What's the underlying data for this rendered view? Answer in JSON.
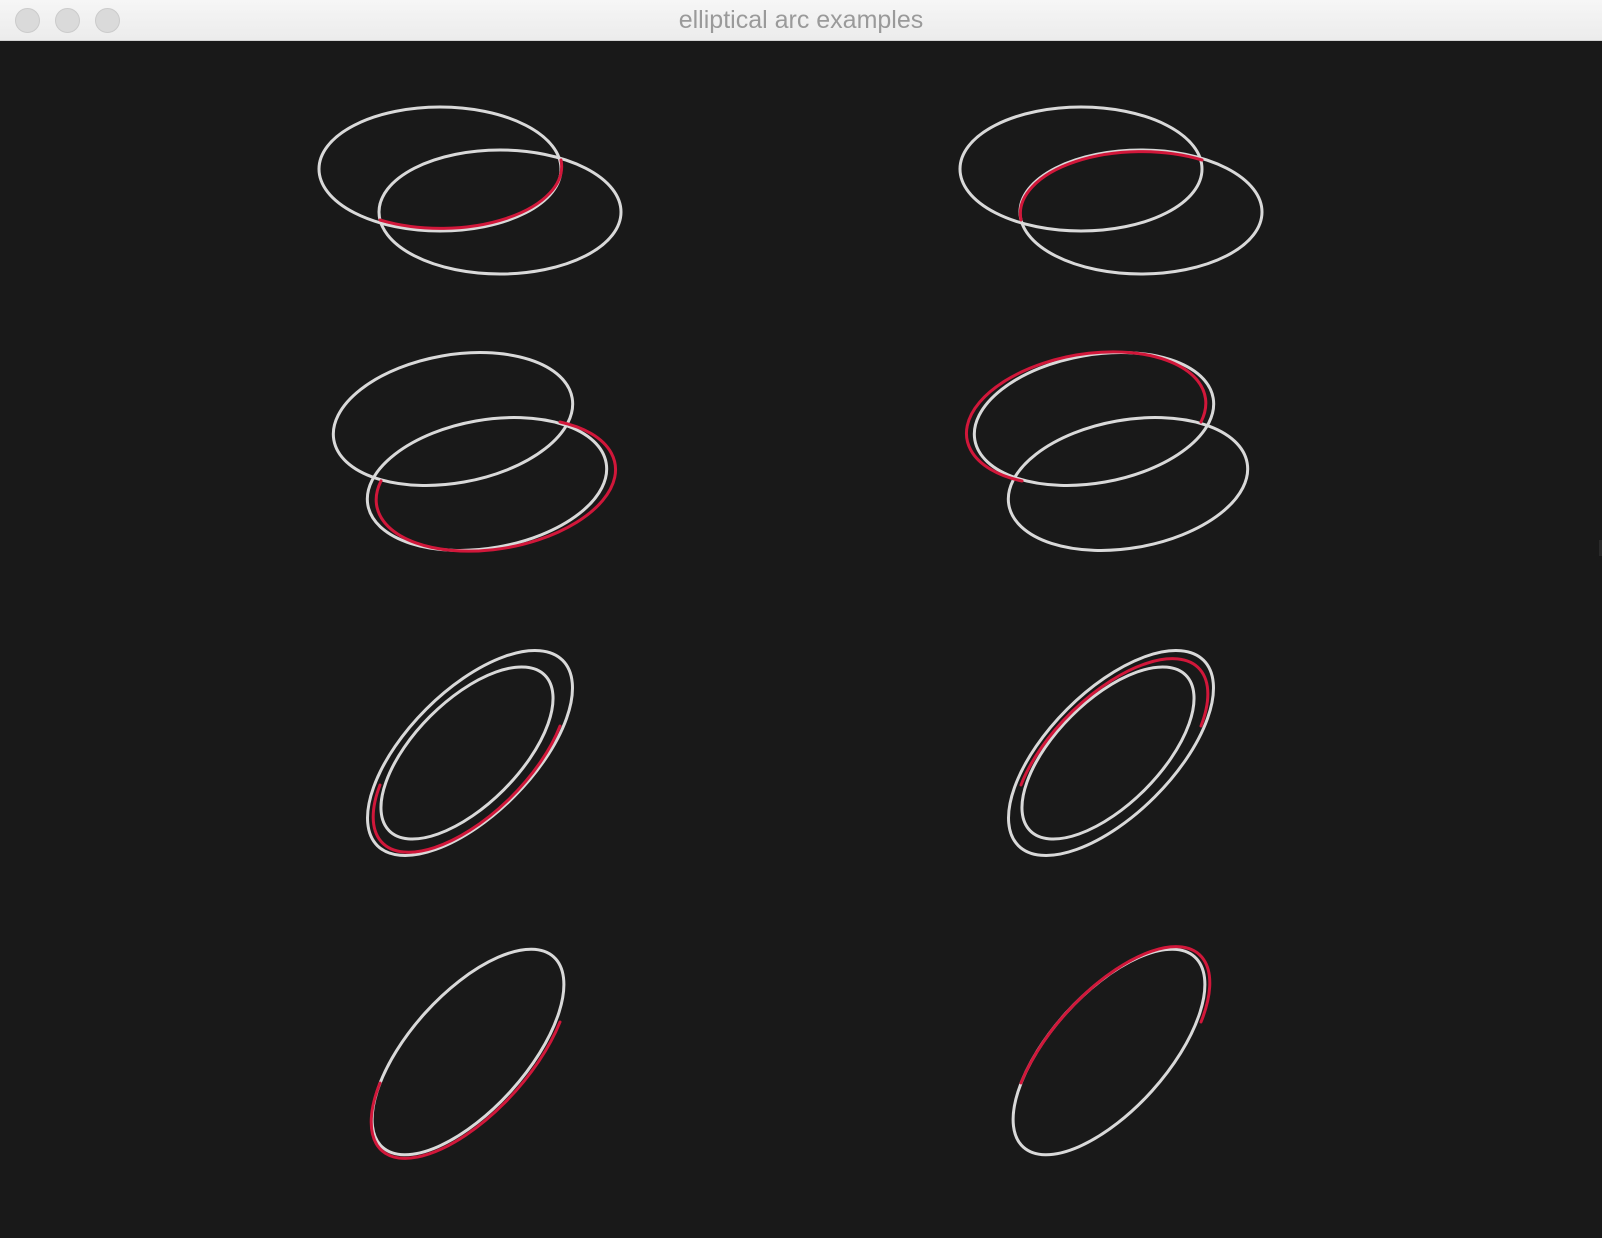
{
  "window": {
    "title": "elliptical arc examples"
  },
  "colors": {
    "background": "#191919",
    "ellipse": "#d9d9d9",
    "arc": "#d1173a"
  },
  "examples": [
    {
      "row": 1,
      "column": "left",
      "arc_flags": "large-arc=0, sweep=1"
    },
    {
      "row": 1,
      "column": "right",
      "arc_flags": "large-arc=0, sweep=0"
    },
    {
      "row": 2,
      "column": "left",
      "arc_flags": "large-arc=1, sweep=1"
    },
    {
      "row": 2,
      "column": "right",
      "arc_flags": "large-arc=1, sweep=0"
    }
  ]
}
